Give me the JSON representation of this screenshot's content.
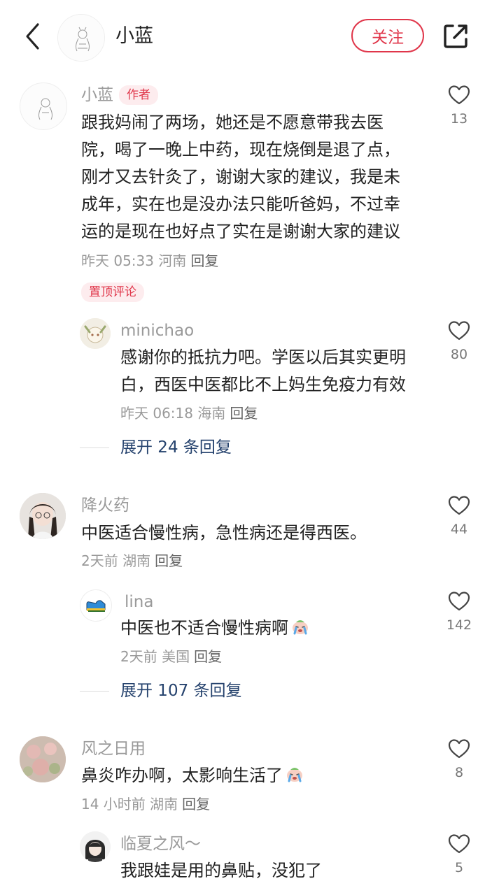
{
  "header": {
    "title": "小蓝",
    "follow_label": "关注"
  },
  "colors": {
    "accent": "#e0364a",
    "link": "#26436e"
  },
  "comments": [
    {
      "name": "小蓝",
      "author_tag": "作者",
      "text_lines": [
        "跟我妈闹了两场，她还是不愿意带我去医",
        "院，喝了一晚上中药，现在烧倒是退了点，",
        "刚才又去针灸了，谢谢大家的建议，我是未",
        "成年，实在也是没办法只能听爸妈，不过幸",
        "运的是现在也好点了实在是谢谢大家的建议"
      ],
      "meta": "昨天 05:33 河南",
      "reply_label": "回复",
      "likes": "13",
      "pin_tag": "置顶评论"
    },
    {
      "name": "minichao",
      "text_lines": [
        "感谢你的抵抗力吧。学医以后其实更明",
        "白，西医中医都比不上妈生免疫力有效"
      ],
      "meta": "昨天 06:18 海南",
      "reply_label": "回复",
      "likes": "80",
      "expand": "展开 24 条回复"
    },
    {
      "name": "降火药",
      "text": "中医适合慢性病，急性病还是得西医。",
      "meta": "2天前 湖南",
      "reply_label": "回复",
      "likes": "44"
    },
    {
      "name": "lina",
      "text": "中医也不适合慢性病啊",
      "emoji": "crying-face-emoji",
      "meta": "2天前 美国",
      "reply_label": "回复",
      "likes": "142",
      "expand": "展开 107 条回复"
    },
    {
      "name": "风之日用",
      "text": "鼻炎咋办啊，太影响生活了",
      "emoji": "crying-face-emoji",
      "meta": "14 小时前 湖南",
      "reply_label": "回复",
      "likes": "8"
    },
    {
      "name": "临夏之风～",
      "text": "我跟娃是用的鼻贴，没犯了",
      "likes": "5"
    }
  ]
}
